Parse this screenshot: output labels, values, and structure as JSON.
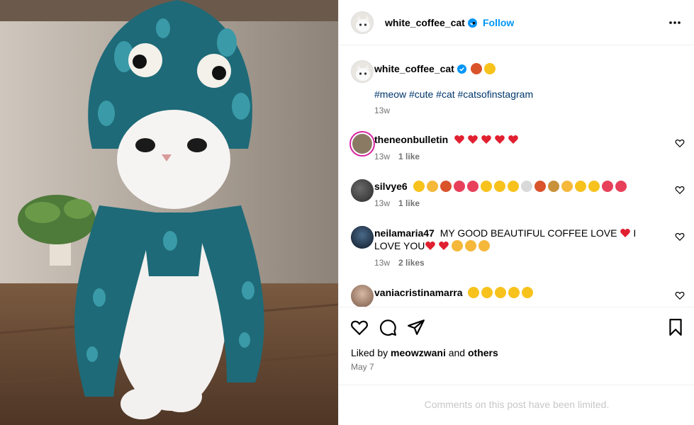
{
  "post": {
    "username": "white_coffee_cat",
    "dot": "•",
    "follow_label": "Follow",
    "caption_emojis": [
      "octopus",
      "cat-face"
    ],
    "hashtags": "#meow #cute #cat #catsofinstagram",
    "caption_time": "13w",
    "liked_by_prefix": "Liked by",
    "liked_by_user": "meowzwani",
    "liked_by_and": "and",
    "liked_by_others": "others",
    "date": "May 7",
    "comments_limited": "Comments on this post have been limited."
  },
  "comments": [
    {
      "username": "theneonbulletin",
      "text": "",
      "emojis": [
        "red-heart",
        "red-heart",
        "red-heart",
        "red-heart",
        "red-heart"
      ],
      "time": "13w",
      "likes": "1 like"
    },
    {
      "username": "silvye6",
      "text": "",
      "emojis": [
        "laughing",
        "clap",
        "octopus",
        "heart-ribbon",
        "heart-ribbon",
        "kiss-face",
        "kiss-face",
        "kiss-face",
        "coffee",
        "paw",
        "dog",
        "thumbs",
        "love-face",
        "love-face",
        "growing-heart",
        "heart-ribbon"
      ],
      "time": "13w",
      "likes": "1 like"
    },
    {
      "username": "neilamaria47",
      "text": "MY GOOD BEAUTIFUL COFFEE LOVE",
      "text2": "I LOVE YOU",
      "time": "13w",
      "likes": "2 likes"
    },
    {
      "username": "vaniacristinamarra",
      "text": "",
      "emojis": [
        "love-face",
        "love-face",
        "love-face",
        "love-face",
        "love-face"
      ],
      "time": "",
      "likes": ""
    }
  ],
  "colors": {
    "follow": "#0095f6",
    "hashtag": "#00376b",
    "muted": "#737373",
    "verified": "#0095f6"
  },
  "icons": [
    "more-icon",
    "verified-icon",
    "heart-icon",
    "comment-icon",
    "share-icon",
    "bookmark-icon"
  ]
}
